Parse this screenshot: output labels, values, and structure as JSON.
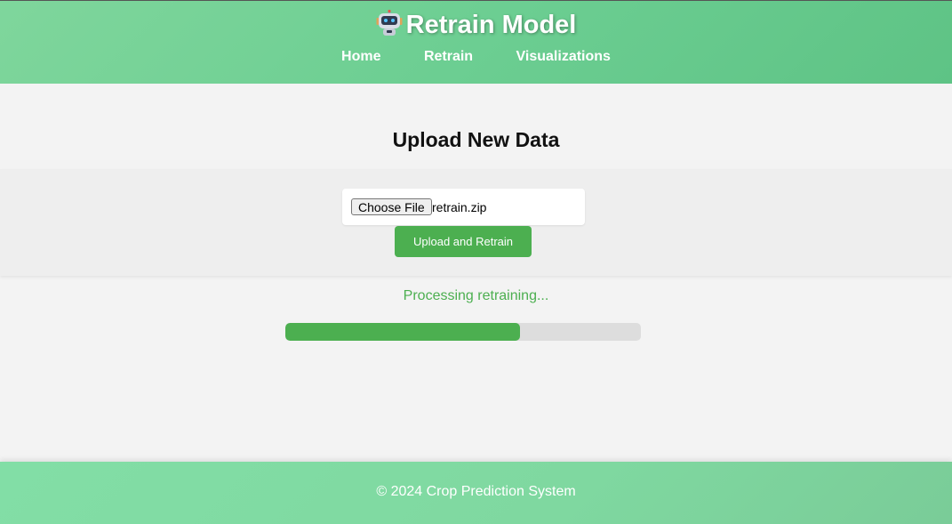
{
  "header": {
    "title": "Retrain Model",
    "icon": "robot-icon",
    "nav": [
      "Home",
      "Retrain",
      "Visualizations"
    ]
  },
  "main": {
    "title": "Upload New Data",
    "file_input": {
      "button_label": "Choose File",
      "file_name": "retrain.zip"
    },
    "upload_button": "Upload and Retrain",
    "status": "Processing retraining...",
    "progress": 0.66
  },
  "footer": {
    "text": "© 2024 Crop Prediction System"
  },
  "colors": {
    "accent": "#4caf50",
    "header_gradient": [
      "#7fd69c",
      "#5ec385"
    ],
    "progress_track": "#dddddd"
  }
}
